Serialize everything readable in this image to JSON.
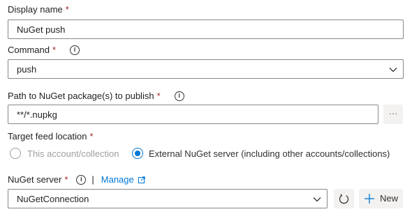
{
  "display_name": {
    "label": "Display name",
    "required": "*",
    "value": "NuGet push"
  },
  "command": {
    "label": "Command",
    "required": "*",
    "value": "push",
    "info_icon": "info-icon"
  },
  "path": {
    "label": "Path to NuGet package(s) to publish",
    "required": "*",
    "value": "**/*.nupkg",
    "browse_label": "···"
  },
  "target_feed": {
    "label": "Target feed location",
    "required": "*",
    "options": [
      "This account/collection",
      "External NuGet server (including other accounts/collections)"
    ],
    "selected_index": 1
  },
  "nuget_server": {
    "label": "NuGet server",
    "required": "*",
    "separator": "|",
    "manage_label": "Manage",
    "value": "NuGetConnection",
    "new_label": "New"
  },
  "colors": {
    "accent": "#0078d4",
    "required": "#a4262c",
    "border": "#8a8886",
    "disabled": "#a19f9d"
  }
}
